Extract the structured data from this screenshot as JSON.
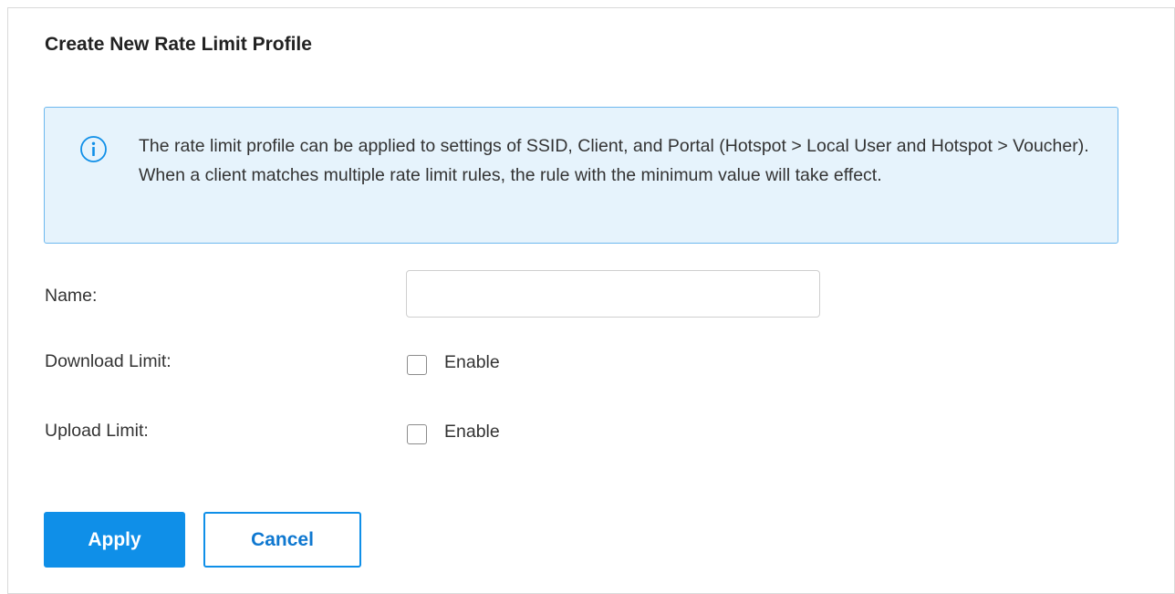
{
  "page": {
    "title": "Create New Rate Limit Profile"
  },
  "notice": {
    "icon": "info-icon",
    "text": "The rate limit profile can be applied to settings of SSID, Client, and Portal (Hotspot > Local User and Hotspot > Voucher). When a client matches multiple rate limit rules, the rule with the minimum value will take effect."
  },
  "form": {
    "name": {
      "label": "Name:",
      "value": "",
      "placeholder": ""
    },
    "download_limit": {
      "label": "Download Limit:",
      "checkbox_label": "Enable",
      "checked": false
    },
    "upload_limit": {
      "label": "Upload Limit:",
      "checkbox_label": "Enable",
      "checked": false
    }
  },
  "buttons": {
    "apply_label": "Apply",
    "cancel_label": "Cancel"
  },
  "colors": {
    "accent": "#0f8fe8",
    "notice_background": "#e6f3fc",
    "notice_border": "#6db8ef"
  }
}
